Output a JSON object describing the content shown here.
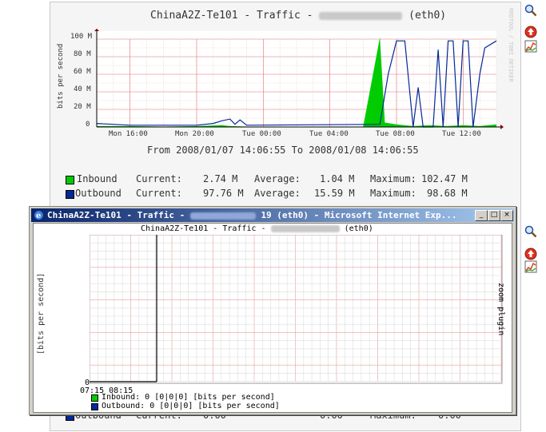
{
  "main_graph": {
    "title_prefix": "ChinaA2Z-Te101 - Traffic -",
    "title_suffix": "(eth0)",
    "y_axis_label": "bits per second",
    "y_ticks": [
      "100 M",
      "80 M",
      "60 M",
      "40 M",
      "20 M",
      "0"
    ],
    "x_ticks": [
      "Mon 16:00",
      "Mon 20:00",
      "Tue 00:00",
      "Tue 04:00",
      "Tue 08:00",
      "Tue 12:00"
    ],
    "side_label": "RRDTOOL / TOBI OETIKER",
    "date_range": "From 2008/01/07 14:06:55 To 2008/01/08 14:06:55",
    "colors": {
      "inbound": "#00cc00",
      "outbound": "#002a97",
      "grid": "#f0a0a0"
    }
  },
  "legend": {
    "inbound": {
      "name": "Inbound",
      "current_label": "Current:",
      "current": "2.74 M",
      "average_label": "Average:",
      "average": "1.04 M",
      "maximum_label": "Maximum:",
      "maximum": "102.47 M"
    },
    "outbound": {
      "name": "Outbound",
      "current_label": "Current:",
      "current": "97.76 M",
      "average_label": "Average:",
      "average": "15.59 M",
      "maximum_label": "Maximum:",
      "maximum": "98.68 M"
    },
    "outbound_hidden": {
      "name": "Outbound",
      "current_label": "Current:",
      "current": "0.00",
      "average": "0.00",
      "maximum_label": "Maximum:",
      "maximum": "0.00"
    }
  },
  "chart_data": {
    "type": "line",
    "x_start": "Mon 14:07",
    "x_end": "Tue 14:07",
    "ylim": [
      0,
      100
    ],
    "ylabel": "bits per second",
    "series": [
      {
        "name": "Inbound",
        "color": "#00cc00",
        "points": [
          [
            0,
            1
          ],
          [
            2,
            1
          ],
          [
            4,
            0.5
          ],
          [
            6,
            1
          ],
          [
            7.5,
            2
          ],
          [
            8,
            1
          ],
          [
            9,
            0.5
          ],
          [
            16,
            0.5
          ],
          [
            17,
            102
          ],
          [
            17.3,
            5
          ],
          [
            18,
            3
          ],
          [
            19,
            1
          ],
          [
            20,
            2
          ],
          [
            21,
            1
          ],
          [
            22,
            2
          ],
          [
            23,
            1
          ],
          [
            24,
            3
          ]
        ]
      },
      {
        "name": "Outbound",
        "color": "#002a97",
        "points": [
          [
            0,
            4
          ],
          [
            1,
            3
          ],
          [
            2,
            2
          ],
          [
            3,
            2
          ],
          [
            4,
            2
          ],
          [
            5,
            2
          ],
          [
            6,
            2
          ],
          [
            7,
            4
          ],
          [
            7.5,
            7
          ],
          [
            8,
            9
          ],
          [
            8.3,
            3
          ],
          [
            8.6,
            8
          ],
          [
            9,
            2
          ],
          [
            17,
            3
          ],
          [
            17.5,
            60
          ],
          [
            18,
            98
          ],
          [
            18.5,
            98
          ],
          [
            19,
            0
          ],
          [
            19.3,
            45
          ],
          [
            19.6,
            0
          ],
          [
            20.2,
            0
          ],
          [
            20.5,
            88
          ],
          [
            20.8,
            0
          ],
          [
            21.1,
            98
          ],
          [
            21.4,
            98
          ],
          [
            21.7,
            0
          ],
          [
            22,
            98
          ],
          [
            22.3,
            98
          ],
          [
            22.6,
            0
          ],
          [
            23,
            60
          ],
          [
            23.3,
            90
          ],
          [
            24,
            98
          ]
        ]
      }
    ]
  },
  "popup": {
    "window_title_prefix": "ChinaA2Z-Te101 - Traffic -",
    "window_title_suffix": "19 (eth0) - Microsoft Internet Exp...",
    "minimize": "_",
    "maximize": "□",
    "close": "×",
    "graph_title_prefix": "ChinaA2Z-Te101 - Traffic -",
    "graph_title_suffix": "(eth0)",
    "y_axis_label": "[bits per second]",
    "right_label": "zoom plugin",
    "y_zero": "0",
    "x_tick": "07:15 08:15",
    "inbound_line": "Inbound: 0 [0|0|0] [bits per second]",
    "outbound_line": "Outbound: 0 [0|0|0] [bits per second]"
  },
  "icons": [
    "magnifier-icon",
    "go-up-icon",
    "graph-icon"
  ]
}
